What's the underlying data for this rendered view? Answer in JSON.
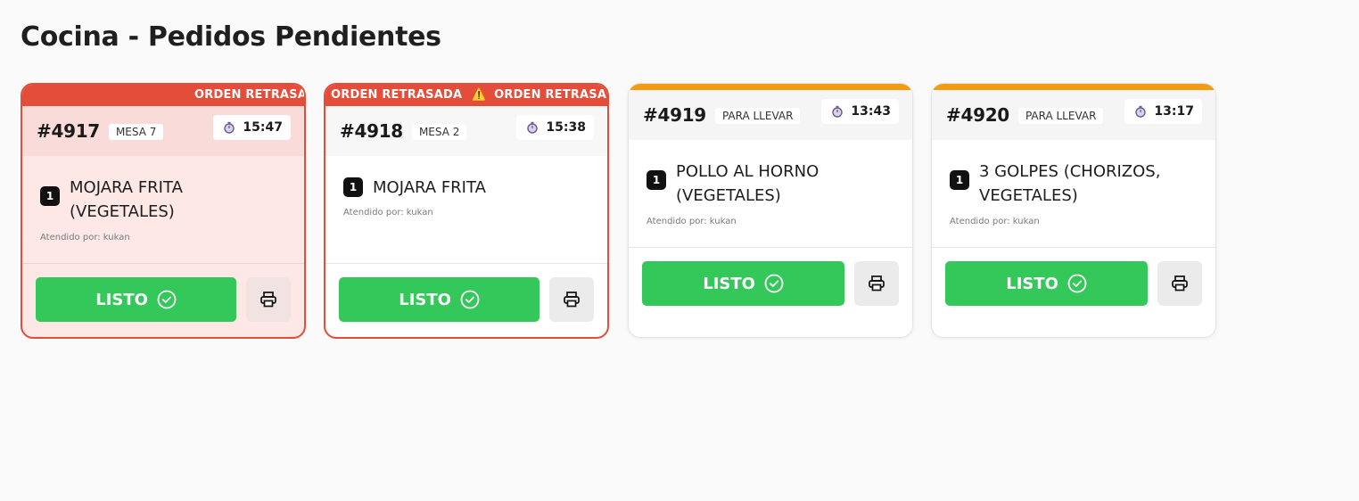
{
  "page": {
    "title": "Cocina - Pedidos Pendientes"
  },
  "colors": {
    "delayed": "#e44d3a",
    "pending_accent": "#f39c12",
    "done_button": "#34c759"
  },
  "orders": [
    {
      "number": "#4917",
      "type": "MESA 7",
      "timer": "15:47",
      "timer_icon": "stopwatch-icon",
      "banner": "ORDEN RETRASADA",
      "items": [
        {
          "qty": "1",
          "name": "MOJARA FRITA (VEGETALES)"
        }
      ],
      "attended_by": "Atendido por: kukan",
      "done_label": "LISTO",
      "done_icon": "check-circle-icon",
      "print_icon": "printer-icon"
    },
    {
      "number": "#4918",
      "type": "MESA 2",
      "timer": "15:38",
      "timer_icon": "stopwatch-icon",
      "banner": "ORDEN RETRASADA",
      "banner_icon": "⚠️",
      "items": [
        {
          "qty": "1",
          "name": "MOJARA FRITA"
        }
      ],
      "attended_by": "Atendido por: kukan",
      "done_label": "LISTO",
      "done_icon": "check-circle-icon",
      "print_icon": "printer-icon"
    },
    {
      "number": "#4919",
      "type": "PARA LLEVAR",
      "timer": "13:43",
      "timer_icon": "stopwatch-icon",
      "items": [
        {
          "qty": "1",
          "name": "POLLO AL HORNO (VEGETALES)"
        }
      ],
      "attended_by": "Atendido por: kukan",
      "done_label": "LISTO",
      "done_icon": "check-circle-icon",
      "print_icon": "printer-icon"
    },
    {
      "number": "#4920",
      "type": "PARA LLEVAR",
      "timer": "13:17",
      "timer_icon": "stopwatch-icon",
      "items": [
        {
          "qty": "1",
          "name": "3 GOLPES (CHORIZOS, VEGETALES)"
        }
      ],
      "attended_by": "Atendido por: kukan",
      "done_label": "LISTO",
      "done_icon": "check-circle-icon",
      "print_icon": "printer-icon"
    }
  ]
}
